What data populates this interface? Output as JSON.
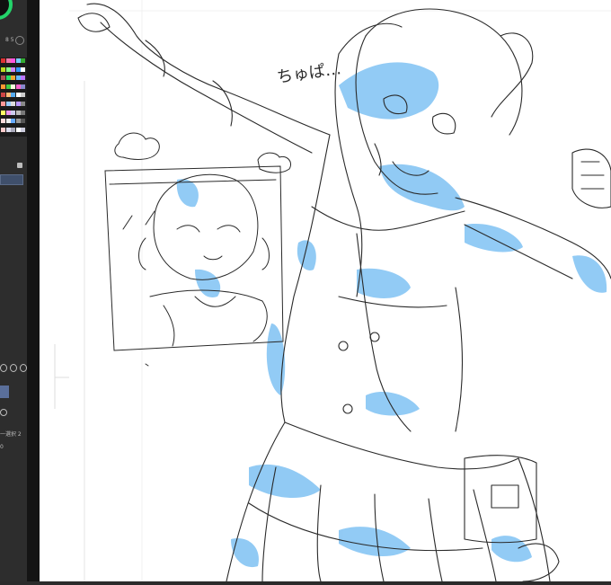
{
  "app": {
    "panel": {
      "size_readout": "8   5",
      "layer_readout": "一選択 2",
      "small_value": "0",
      "palette_colors": [
        "#d33",
        "#e7a",
        "#f5d",
        "#7cf",
        "#3a3",
        "#bd2",
        "#8f8",
        "#c8f",
        "#39f",
        "#fff",
        "#a55",
        "#2d6",
        "#ea3",
        "#6bf",
        "#b7f",
        "#f93",
        "#4c4",
        "#ffd",
        "#f6c",
        "#88c",
        "#c44",
        "#fb7",
        "#5ae",
        "#fff",
        "#ccc",
        "#f99",
        "#9cf",
        "#ddd",
        "#b9f",
        "#888",
        "#ff6",
        "#e9e",
        "#cce",
        "#bbb",
        "#777",
        "#fdd",
        "#eee",
        "#6af",
        "#999",
        "#555",
        "#fcc",
        "#dde",
        "#aab",
        "#fff",
        "#ccd"
      ]
    },
    "canvas": {
      "handwritten_note": "ちゅぱ…",
      "ink_color": "#2a2a2a",
      "fill_color": "#8cc8f4"
    }
  }
}
